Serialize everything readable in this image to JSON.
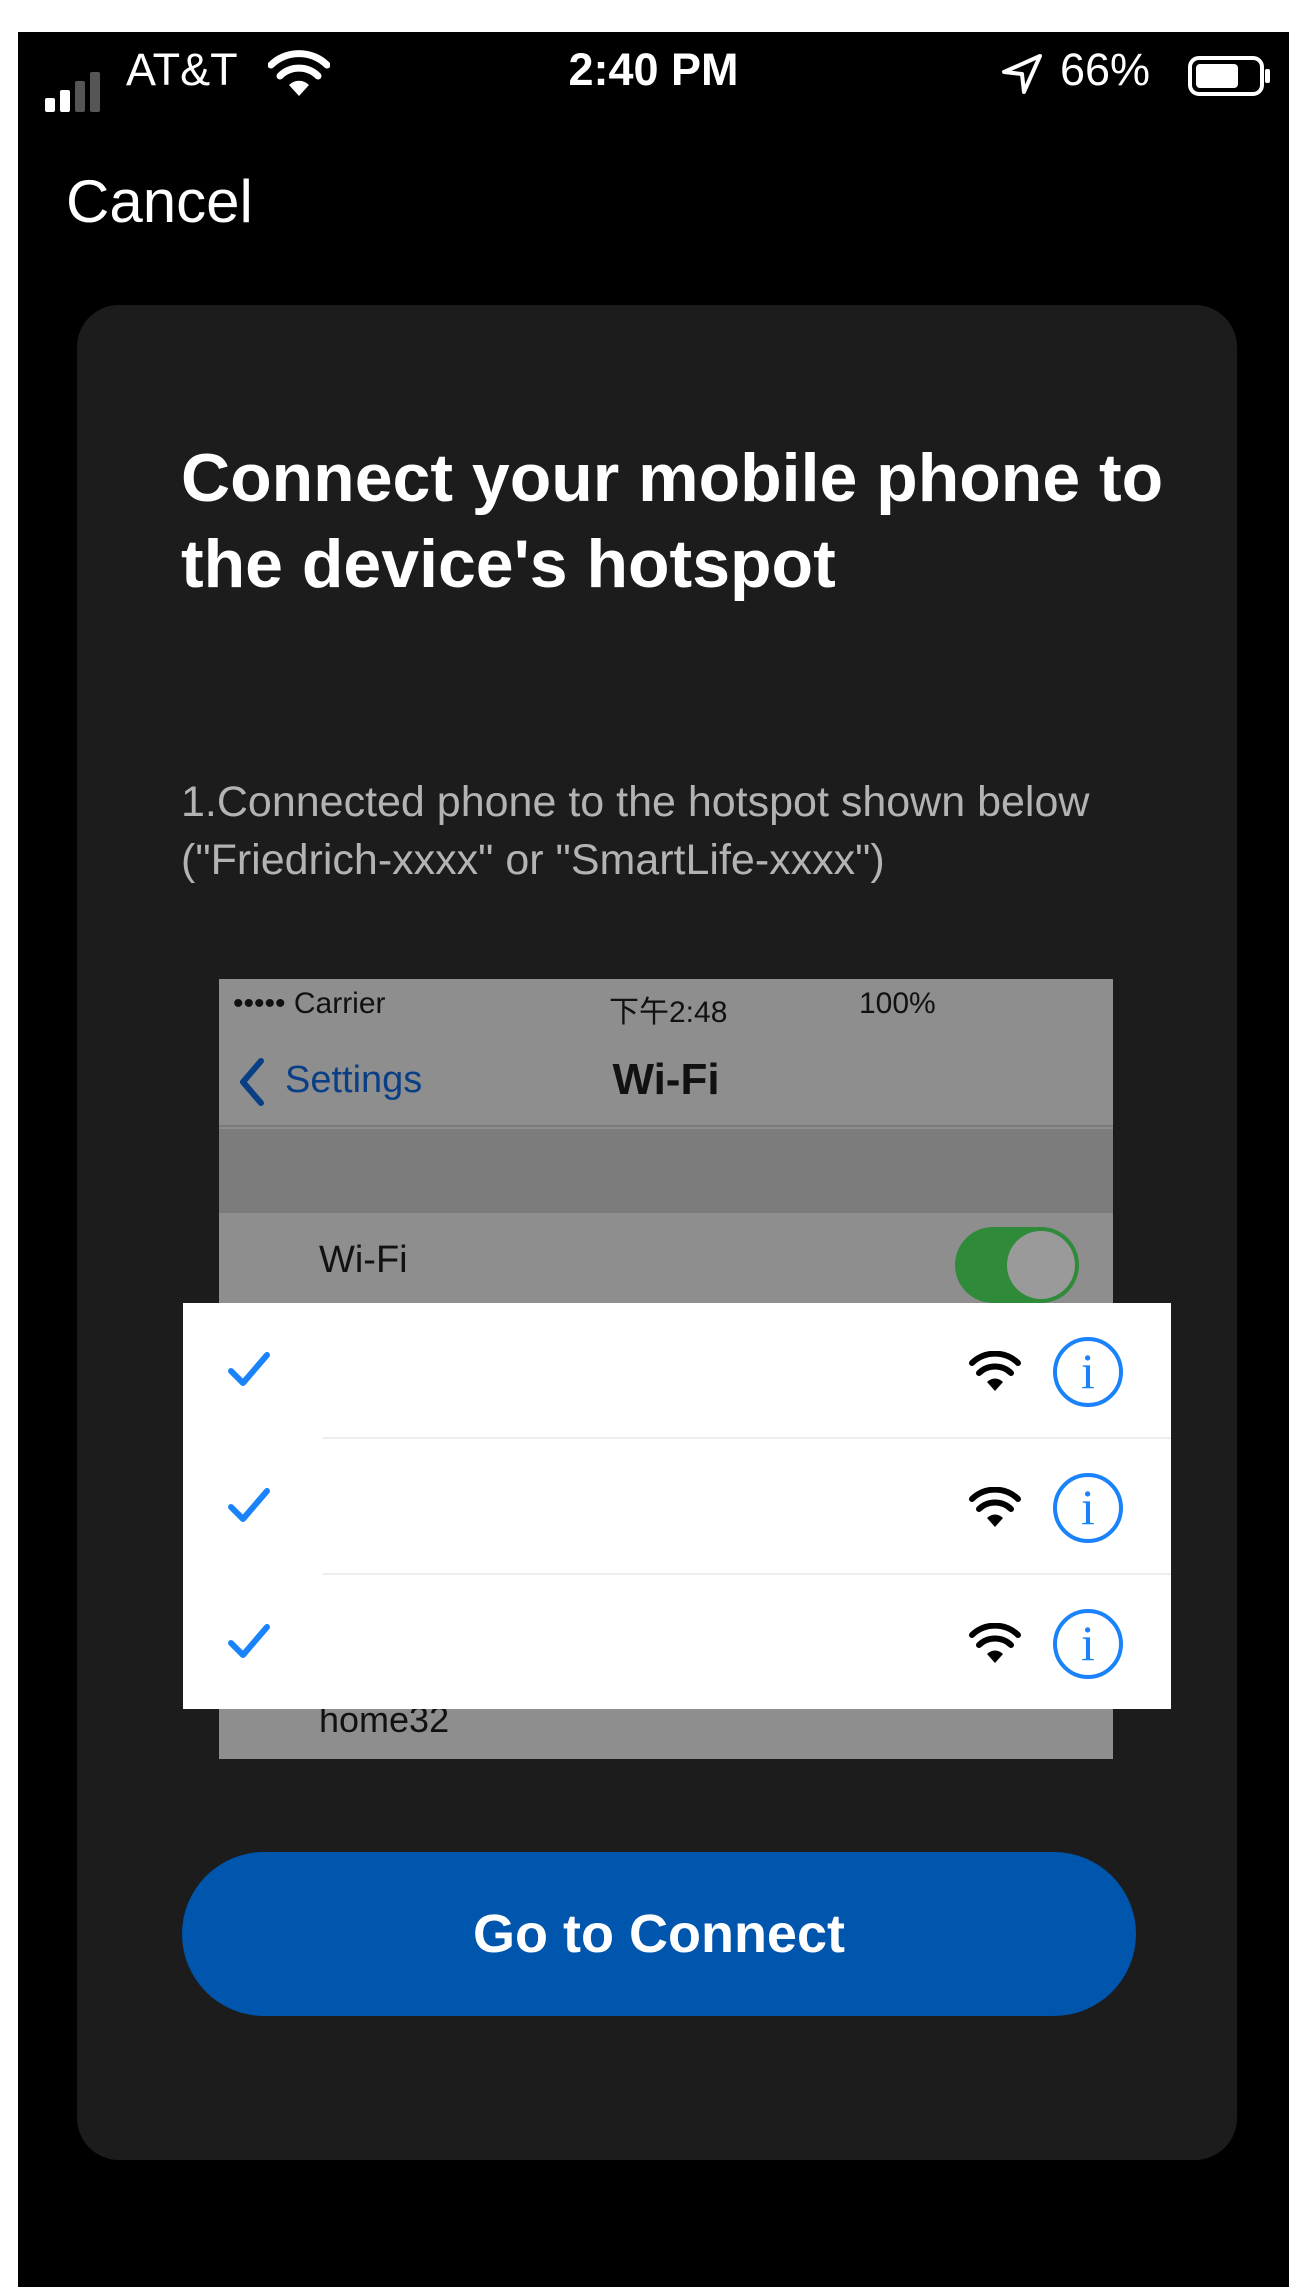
{
  "status_bar": {
    "carrier": "AT&T",
    "time": "2:40 PM",
    "battery": "66%",
    "icons": [
      "signal-icon",
      "wifi-icon",
      "location-arrow-icon",
      "battery-icon"
    ]
  },
  "nav": {
    "cancel_label": "Cancel"
  },
  "card": {
    "title": "Connect your mobile phone to the device's hotspot",
    "instruction": "1.Connected phone to the hotspot shown below (\"Friedrich-xxxx\" or \"SmartLife-xxxx\")"
  },
  "illustration": {
    "carrier": "••••• Carrier",
    "time": "下午2:48",
    "battery": "100%",
    "back_label": "Settings",
    "title": "Wi-Fi",
    "wifi_label": "Wi-Fi",
    "wifi_toggle_on": true,
    "footer_text": "home32"
  },
  "network_list": {
    "rows": [
      {
        "name": "",
        "selected": true,
        "icons": [
          "checkmark-icon",
          "wifi-icon",
          "info-icon"
        ]
      },
      {
        "name": "",
        "selected": true,
        "icons": [
          "checkmark-icon",
          "wifi-icon",
          "info-icon"
        ]
      },
      {
        "name": "",
        "selected": true,
        "icons": [
          "checkmark-icon",
          "wifi-icon",
          "info-icon"
        ]
      }
    ],
    "info_glyph": "i"
  },
  "actions": {
    "connect_label": "Go to Connect"
  },
  "colors": {
    "background": "#000000",
    "card": "#1c1c1c",
    "accent_button": "#0055ad",
    "ios_blue": "#1a82fb"
  }
}
